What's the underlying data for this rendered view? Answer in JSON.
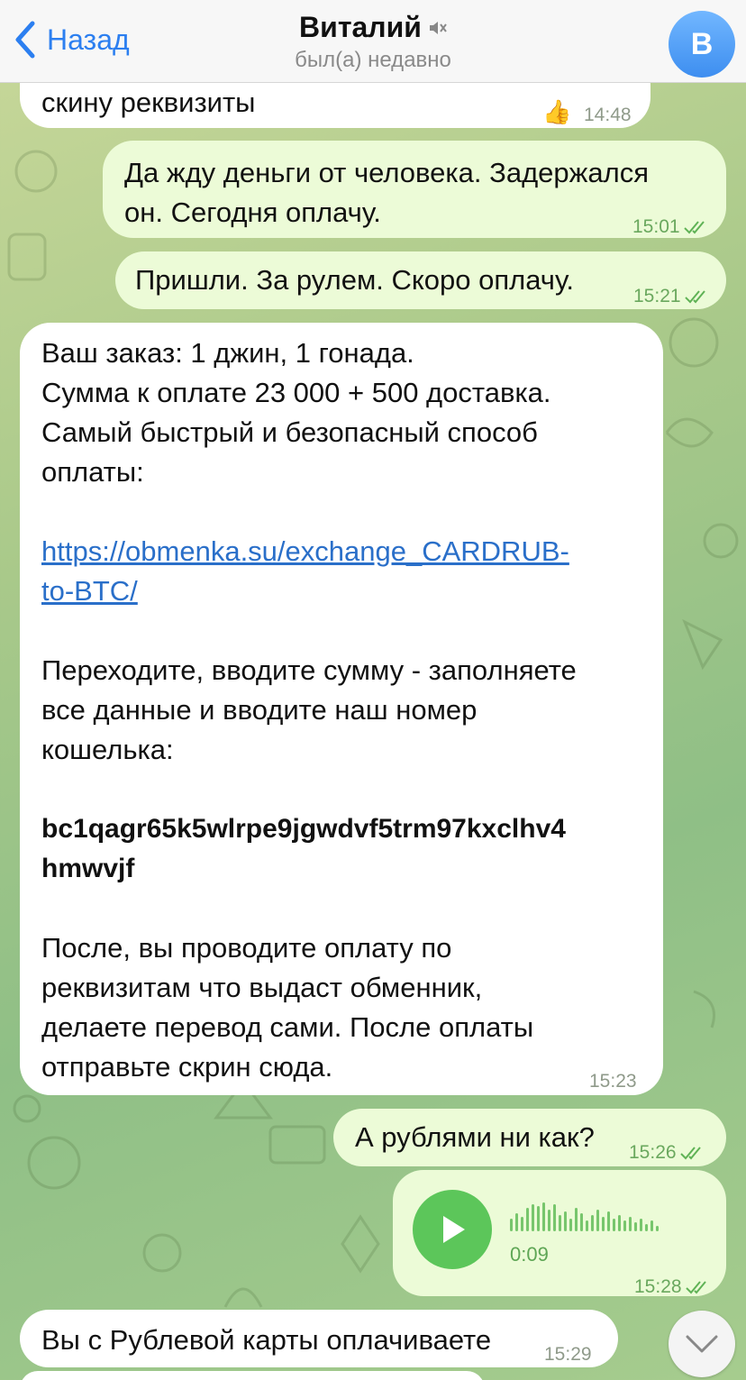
{
  "header": {
    "back_label": "Назад",
    "contact_name": "Виталий",
    "status": "был(а) недавно",
    "avatar_letter": "В"
  },
  "messages": [
    {
      "dir": "in",
      "text": "скину реквизиты",
      "reaction": "👍",
      "time": "14:48"
    },
    {
      "dir": "out",
      "lines": [
        "Да жду деньги от человека. Задержался",
        "он. Сегодня оплачу."
      ],
      "time": "15:01"
    },
    {
      "dir": "out",
      "text": "Пришли. За рулем. Скоро оплачу.",
      "time": "15:21"
    },
    {
      "dir": "in",
      "lines": [
        "Ваш заказ: 1 джин, 1 гонада.",
        "Сумма к оплате 23 000 + 500 доставка.",
        "Самый быстрый и безопасный способ",
        "оплаты:",
        "",
        "https://obmenka.su/exchange_CARDRUB-",
        "to-BTC/",
        "",
        "Переходите, вводите сумму - заполняете",
        "все данные и вводите наш номер",
        "кошелька:",
        "",
        "bc1qagr65k5wlrpe9jgwdvf5trm97kxclhv4",
        "hmwvjf",
        "",
        "После, вы проводите оплату по",
        "реквизитам что выдаст обменник,",
        "делаете перевод сами. После оплаты",
        "отправьте скрин сюда."
      ],
      "time": "15:23"
    },
    {
      "dir": "out",
      "text": "А рублями ни как?",
      "time": "15:26"
    },
    {
      "dir": "out",
      "type": "voice",
      "duration": "0:09",
      "time": "15:28"
    },
    {
      "dir": "in",
      "text": "Вы с Рублевой карты оплачиваете",
      "time": "15:29"
    }
  ],
  "icons": {
    "back": "chevron-left-icon",
    "mute": "muted-speaker-icon",
    "read": "double-check-icon",
    "play": "play-icon",
    "scroll": "chevron-down-icon"
  },
  "colors": {
    "accent": "#2c7ff0",
    "outgoing_bubble": "#ecfbd7",
    "incoming_bubble": "#ffffff",
    "voice_button": "#5cc65a"
  }
}
